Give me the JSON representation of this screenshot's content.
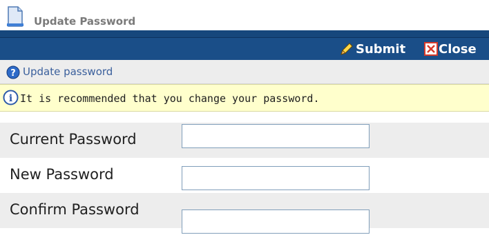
{
  "page": {
    "title": "Update Password"
  },
  "toolbar": {
    "submit_label": "Submit",
    "close_label": "Close"
  },
  "help": {
    "text": "Update password"
  },
  "notice": {
    "text": "It is recommended that you change your password."
  },
  "form": {
    "fields": [
      {
        "label": "Current Password",
        "value": ""
      },
      {
        "label": "New Password",
        "value": ""
      },
      {
        "label": "Confirm Password",
        "value": ""
      }
    ]
  },
  "colors": {
    "toolbar_bg": "#1a4e88",
    "row_alt_bg": "#ededed",
    "notice_bg": "#ffffcc",
    "help_text": "#3a5f9c",
    "input_border": "#7f9db9"
  },
  "icons": {
    "title_icon": "document-icon",
    "submit_icon": "pencil-icon",
    "close_icon": "close-box-icon",
    "help_icon": "help-question-icon",
    "info_icon": "info-icon"
  }
}
